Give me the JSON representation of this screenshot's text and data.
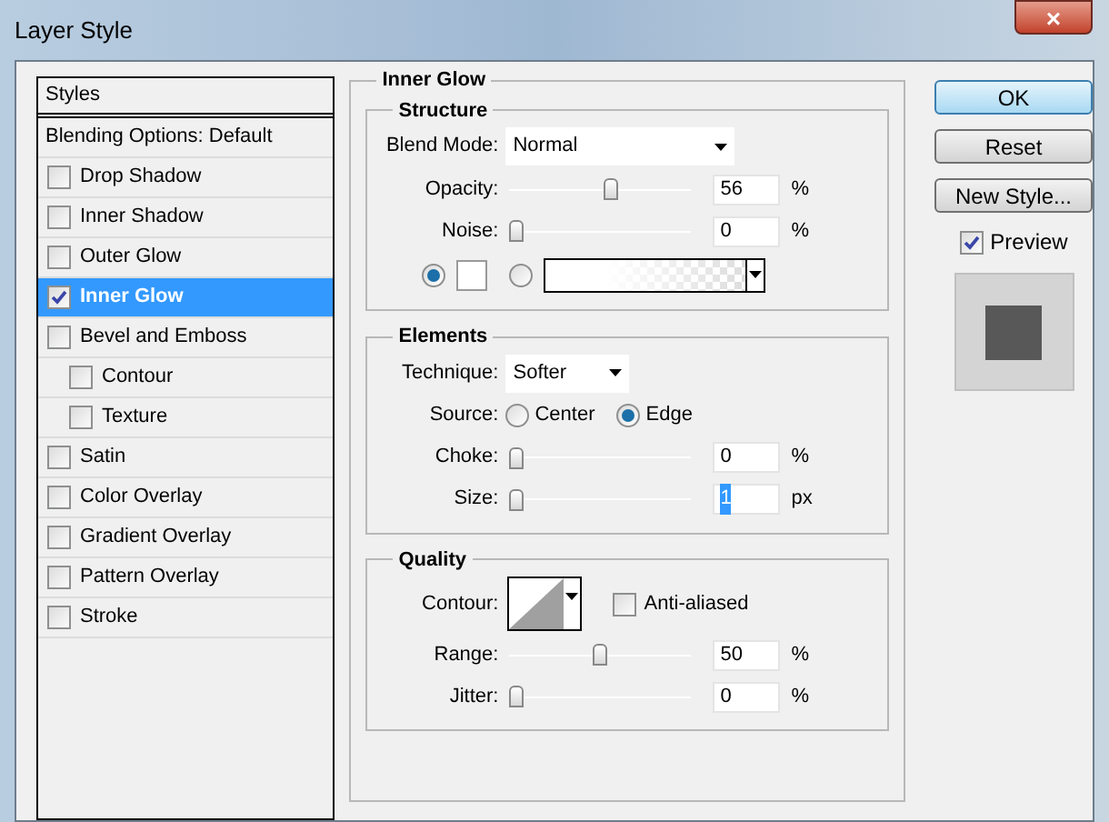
{
  "window": {
    "title": "Layer Style",
    "close": "×"
  },
  "sidebar": {
    "header": "Styles",
    "items": [
      {
        "label": "Blending Options: Default",
        "kind": "option",
        "selected": false
      },
      {
        "label": "Drop Shadow",
        "kind": "effect",
        "checked": false,
        "selected": false
      },
      {
        "label": "Inner Shadow",
        "kind": "effect",
        "checked": false,
        "selected": false
      },
      {
        "label": "Outer Glow",
        "kind": "effect",
        "checked": false,
        "selected": false
      },
      {
        "label": "Inner Glow",
        "kind": "effect",
        "checked": true,
        "selected": true
      },
      {
        "label": "Bevel and Emboss",
        "kind": "effect",
        "checked": false,
        "selected": false,
        "children": [
          {
            "label": "Contour",
            "kind": "effect",
            "checked": false,
            "selected": false
          },
          {
            "label": "Texture",
            "kind": "effect",
            "checked": false,
            "selected": false
          }
        ]
      },
      {
        "label": "Satin",
        "kind": "effect",
        "checked": false,
        "selected": false
      },
      {
        "label": "Color Overlay",
        "kind": "effect",
        "checked": false,
        "selected": false
      },
      {
        "label": "Gradient Overlay",
        "kind": "effect",
        "checked": false,
        "selected": false
      },
      {
        "label": "Pattern Overlay",
        "kind": "effect",
        "checked": false,
        "selected": false
      },
      {
        "label": "Stroke",
        "kind": "effect",
        "checked": false,
        "selected": false
      }
    ]
  },
  "panel": {
    "title": "Inner Glow",
    "sections": [
      {
        "title": "Structure",
        "rows": [
          {
            "kind": "dropdown",
            "label": "Blend Mode:",
            "value": "Normal"
          },
          {
            "kind": "slider",
            "label": "Opacity:",
            "level": 0.56,
            "value": "56",
            "unit": "%",
            "focused": false
          },
          {
            "kind": "slider",
            "label": "Noise:",
            "level": 0,
            "value": "0",
            "unit": "%",
            "focused": false
          },
          {
            "kind": "fill",
            "options": [
              {
                "kind": "color",
                "selected": true
              },
              {
                "kind": "gradient",
                "selected": false
              }
            ]
          }
        ]
      },
      {
        "title": "Elements",
        "rows": [
          {
            "kind": "dropdown",
            "label": "Technique:",
            "value": "Softer"
          },
          {
            "kind": "radio",
            "label": "Source:",
            "options": [
              {
                "label": "Center",
                "selected": false
              },
              {
                "label": "Edge",
                "selected": true
              }
            ]
          },
          {
            "kind": "slider",
            "label": "Choke:",
            "level": 0,
            "value": "0",
            "unit": "%",
            "focused": false
          },
          {
            "kind": "slider",
            "label": "Size:",
            "level": 0,
            "value": "1",
            "unit": "px",
            "focused": true
          }
        ]
      },
      {
        "title": "Quality",
        "rows": [
          {
            "kind": "contour",
            "label": "Contour:",
            "checkbox": {
              "label": "Anti-aliased",
              "checked": false
            }
          },
          {
            "kind": "slider",
            "label": "Range:",
            "level": 0.5,
            "value": "50",
            "unit": "%",
            "focused": false
          },
          {
            "kind": "slider",
            "label": "Jitter:",
            "level": 0,
            "value": "0",
            "unit": "%",
            "focused": false
          }
        ]
      }
    ]
  },
  "buttons": [
    {
      "label": "OK",
      "default": true
    },
    {
      "label": "Reset",
      "default": false
    },
    {
      "label": "New Style...",
      "default": false
    }
  ],
  "preview": {
    "label": "Preview",
    "checked": true
  }
}
